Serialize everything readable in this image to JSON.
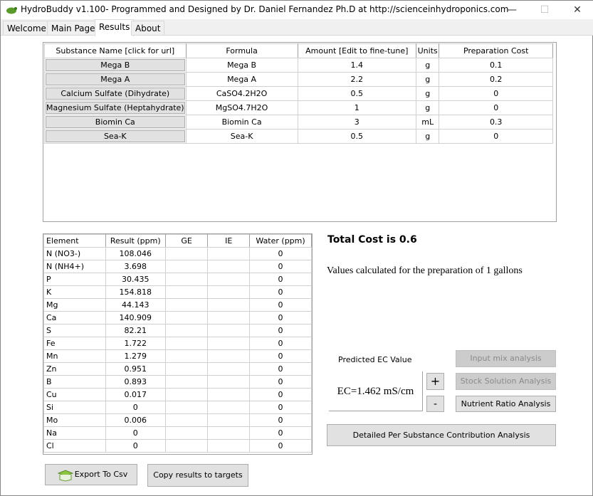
{
  "window": {
    "title": "HydroBuddy v1.100- Programmed and Designed by Dr. Daniel Fernandez Ph.D at http://scienceinhydroponics.com",
    "minimize": "—",
    "maximize": "☐",
    "close": "✕"
  },
  "tabs": [
    {
      "label": "Welcome"
    },
    {
      "label": "Main Page"
    },
    {
      "label": "Results",
      "active": true
    },
    {
      "label": "About"
    }
  ],
  "substances": {
    "headers": [
      "Substance Name [click for url]",
      "Formula",
      "Amount [Edit to fine-tune]",
      "Units",
      "Preparation Cost"
    ],
    "rows": [
      {
        "name": "Mega B",
        "formula": "Mega B",
        "amount": "1.4",
        "units": "g",
        "cost": "0.1"
      },
      {
        "name": "Mega A",
        "formula": "Mega A",
        "amount": "2.2",
        "units": "g",
        "cost": "0.2"
      },
      {
        "name": "Calcium Sulfate (Dihydrate)",
        "formula": "CaSO4.2H2O",
        "amount": "0.5",
        "units": "g",
        "cost": "0"
      },
      {
        "name": "Magnesium Sulfate (Heptahydrate)",
        "formula": "MgSO4.7H2O",
        "amount": "1",
        "units": "g",
        "cost": "0"
      },
      {
        "name": "Biomin Ca",
        "formula": "Biomin Ca",
        "amount": "3",
        "units": "mL",
        "cost": "0.3"
      },
      {
        "name": "Sea-K",
        "formula": "Sea-K",
        "amount": "0.5",
        "units": "g",
        "cost": "0"
      }
    ]
  },
  "elements": {
    "headers": [
      "Element",
      "Result (ppm)",
      "GE",
      "IE",
      "Water (ppm)"
    ],
    "rows": [
      [
        "N (NO3-)",
        "108.046",
        "",
        "",
        "0"
      ],
      [
        "N (NH4+)",
        "3.698",
        "",
        "",
        "0"
      ],
      [
        "P",
        "30.435",
        "",
        "",
        "0"
      ],
      [
        "K",
        "154.818",
        "",
        "",
        "0"
      ],
      [
        "Mg",
        "44.143",
        "",
        "",
        "0"
      ],
      [
        "Ca",
        "140.909",
        "",
        "",
        "0"
      ],
      [
        "S",
        "82.21",
        "",
        "",
        "0"
      ],
      [
        "Fe",
        "1.722",
        "",
        "",
        "0"
      ],
      [
        "Mn",
        "1.279",
        "",
        "",
        "0"
      ],
      [
        "Zn",
        "0.951",
        "",
        "",
        "0"
      ],
      [
        "B",
        "0.893",
        "",
        "",
        "0"
      ],
      [
        "Cu",
        "0.017",
        "",
        "",
        "0"
      ],
      [
        "Si",
        "0",
        "",
        "",
        "0"
      ],
      [
        "Mo",
        "0.006",
        "",
        "",
        "0"
      ],
      [
        "Na",
        "0",
        "",
        "",
        "0"
      ],
      [
        "Cl",
        "0",
        "",
        "",
        "0"
      ]
    ]
  },
  "total_cost": "Total Cost is 0.6",
  "values_note": "Values calculated for the preparation of 1 gallons",
  "ec": {
    "label": "Predicted EC Value",
    "value": "EC=1.462 mS/cm",
    "plus": "+",
    "minus": "-"
  },
  "buttons": {
    "input_mix": "Input mix analysis",
    "stock_solution": "Stock Solution Analysis",
    "nutrient_ratio": "Nutrient Ratio Analysis",
    "detailed": "Detailed Per Substance Contribution Analysis",
    "export": "Export To Csv",
    "copy": "Copy results to targets"
  }
}
